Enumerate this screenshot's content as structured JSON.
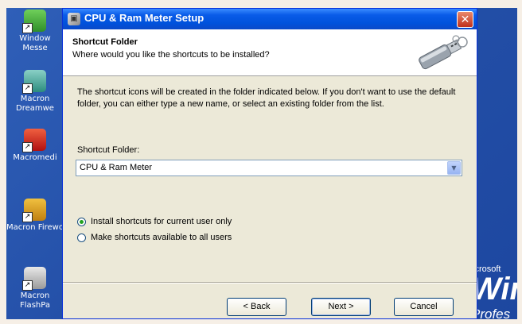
{
  "desktop": {
    "icons": [
      {
        "label": "Window Messe",
        "icon": "msn-icon"
      },
      {
        "label": "Macron Dreamwe",
        "icon": "dreamweaver-icon"
      },
      {
        "label": "Macromedi",
        "icon": "flash-icon"
      },
      {
        "label": "Macron Firewo",
        "icon": "fireworks-icon"
      },
      {
        "label": "Macron FlashPa",
        "icon": "flashpaper-icon"
      }
    ],
    "branding": {
      "line1": "icrosoft",
      "line2": "Win",
      "line3": "Profes"
    }
  },
  "window": {
    "title": "CPU & Ram Meter Setup",
    "icon": "setup-icon",
    "close_glyph": "✕"
  },
  "header": {
    "title": "Shortcut Folder",
    "subtitle": "Where would you like the shortcuts to be installed?",
    "image": "usb-drive-image"
  },
  "body": {
    "description": "The shortcut icons will be created in the folder indicated below. If you don't want to use the default folder, you can either type a new name, or select an existing folder from the list.",
    "folder_label": "Shortcut Folder:",
    "folder_value": "CPU & Ram Meter"
  },
  "options": [
    {
      "label": "Install shortcuts for current user only",
      "selected": true
    },
    {
      "label": "Make shortcuts available to all users",
      "selected": false
    }
  ],
  "buttons": {
    "back": "< Back",
    "next": "Next >",
    "cancel": "Cancel"
  },
  "colors": {
    "titlebar": "#0052dc",
    "desktop": "#2450a8",
    "dialog_face": "#ece9d8",
    "close": "#c0301c"
  }
}
